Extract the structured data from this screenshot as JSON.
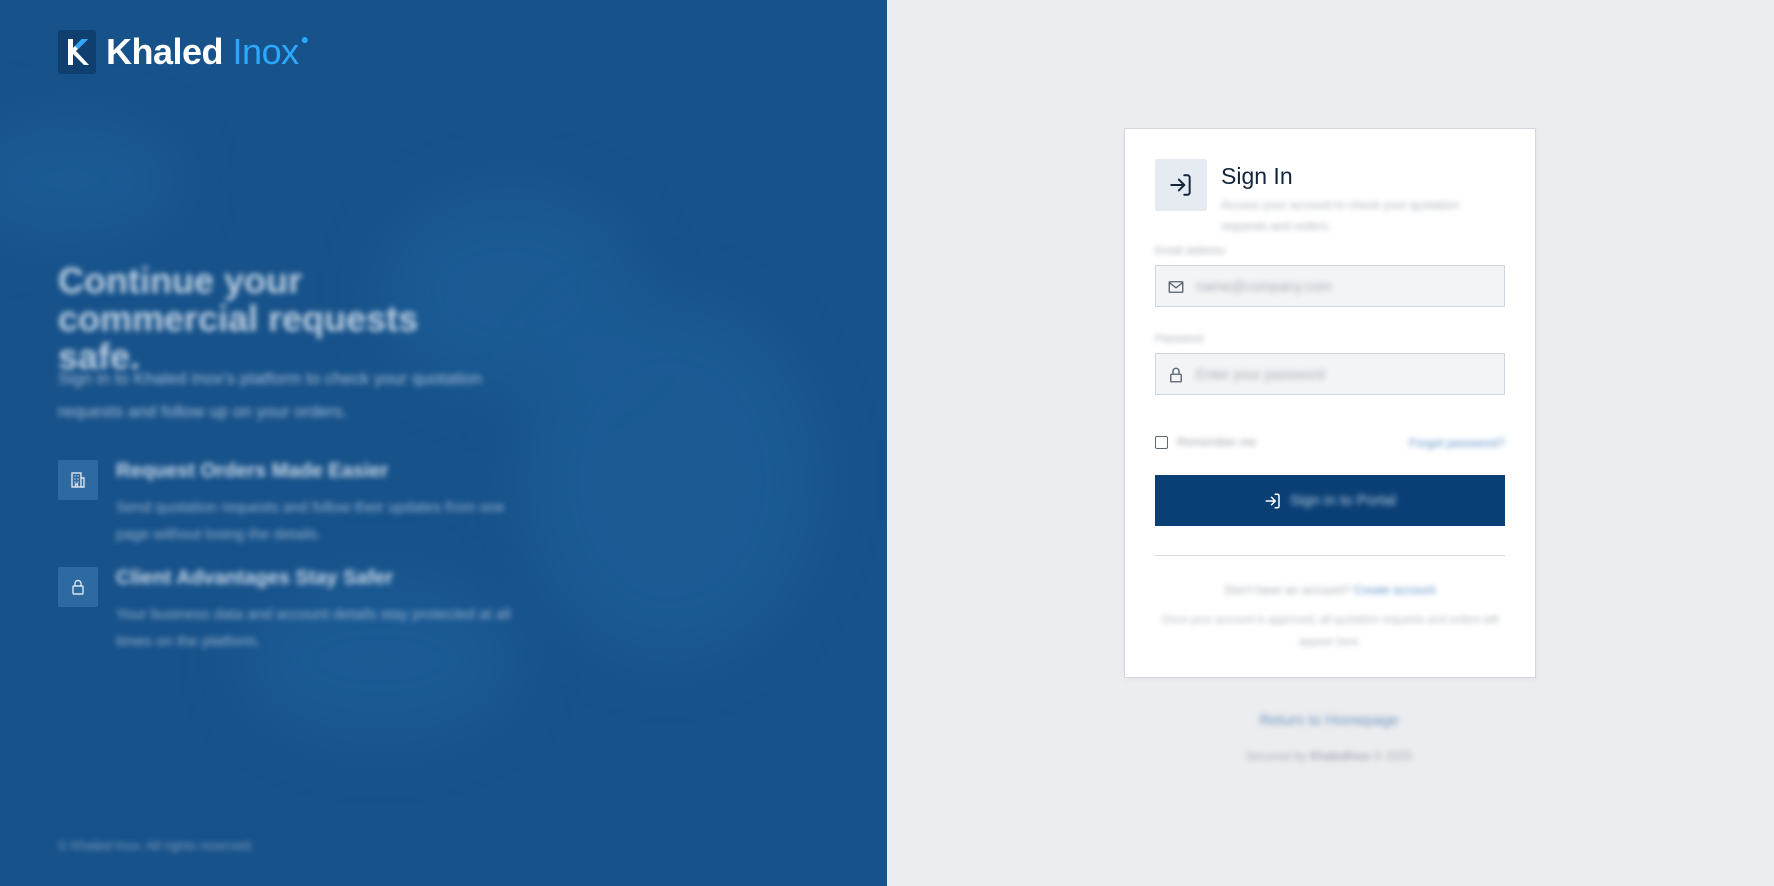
{
  "brand": {
    "name_main": "Khaled",
    "name_accent": "Inox",
    "logo_icon": "k-logo-icon",
    "colors": {
      "panel": "#17528a",
      "accent": "#2da8ff",
      "button": "#0a3f75"
    }
  },
  "left_panel": {
    "headline": "Continue your commercial requests safe.",
    "description": "Sign in to Khaled Inox's platform to check your quotation requests and follow up on your orders.",
    "features": [
      {
        "icon": "building-icon",
        "title": "Request Orders Made Easier",
        "description": "Send quotation requests and follow their updates from one page without losing the details."
      },
      {
        "icon": "lock-icon",
        "title": "Client Advantages Stay Safer",
        "description": "Your business data and account details stay protected at all times on the platform."
      }
    ],
    "copyright": "© Khaled Inox. All rights reserved."
  },
  "card": {
    "icon": "sign-in-icon",
    "title": "Sign In",
    "subtitle": "Access your account to check your quotation requests and orders.",
    "email": {
      "label": "Email address",
      "placeholder": "name@company.com",
      "icon": "mail-icon"
    },
    "password": {
      "label": "Password",
      "placeholder": "Enter your password",
      "icon": "lock-icon"
    },
    "remember_label": "Remember me",
    "forgot_label": "Forgot password?",
    "submit_label": "Sign in to Portal",
    "submit_icon": "sign-in-icon",
    "no_account_text": "Don't have an account?",
    "create_account_label": "Create account",
    "note": "Once your account is approved, all quotation requests and orders will appear here."
  },
  "back_link": "Return to Homepage",
  "footer": {
    "prefix": "Secured by",
    "brand": "KhaledInox",
    "suffix": "© 2025"
  }
}
